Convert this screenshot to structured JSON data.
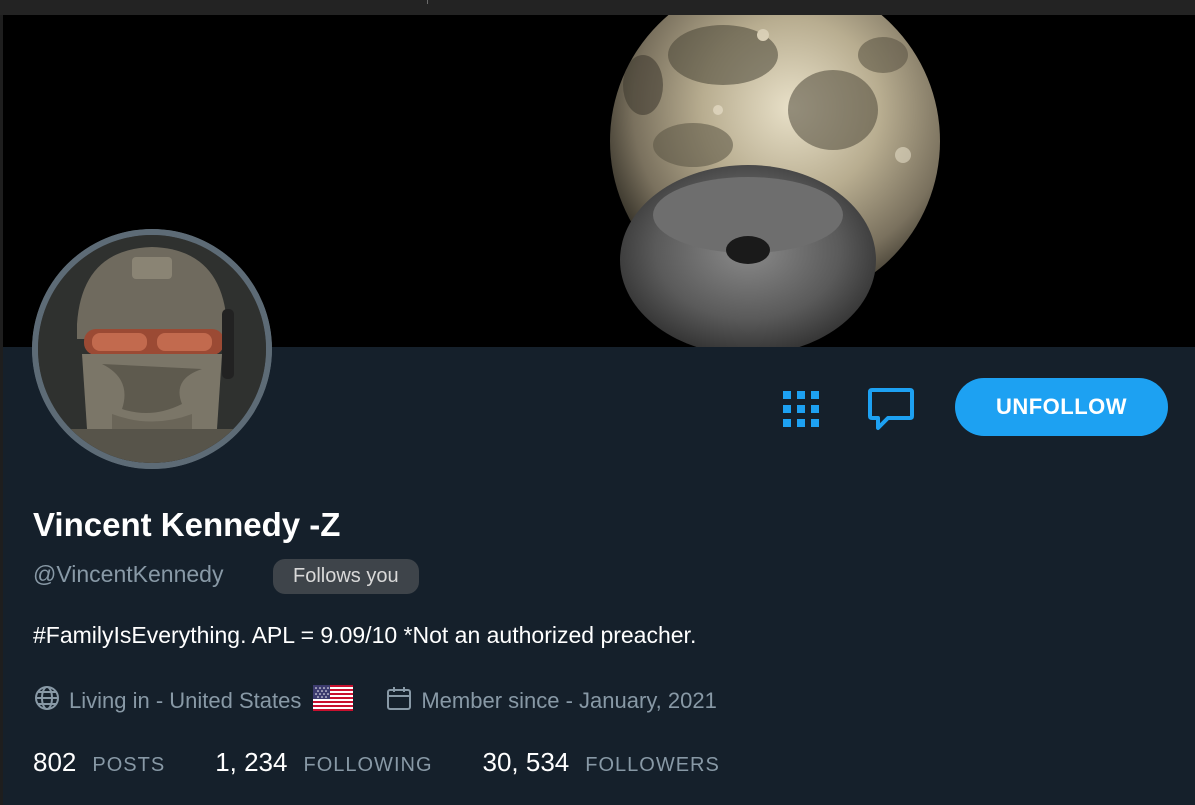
{
  "profile": {
    "display_name": "Vincent Kennedy -Z",
    "handle": "@VincentKennedy",
    "follows_you_badge": "Follows you",
    "bio": "#FamilyIsEverything. APL = 9.09/10 *Not an authorized preacher.",
    "location": "Living in - United States",
    "member_since": "Member since - January, 2021"
  },
  "actions": {
    "unfollow_label": "UNFOLLOW",
    "grid_icon": "grid-icon",
    "message_icon": "message-icon"
  },
  "stats": {
    "posts_count": "802",
    "posts_label": "POSTS",
    "following_count": "1, 234",
    "following_label": "FOLLOWING",
    "followers_count": "30, 534",
    "followers_label": "FOLLOWERS"
  },
  "icons": {
    "globe": "globe-icon",
    "calendar": "calendar-icon",
    "flag": "us-flag-icon"
  },
  "colors": {
    "background": "#15202b",
    "accent": "#1da1f2",
    "muted_text": "#8899a6",
    "badge_bg": "#3e444a"
  }
}
